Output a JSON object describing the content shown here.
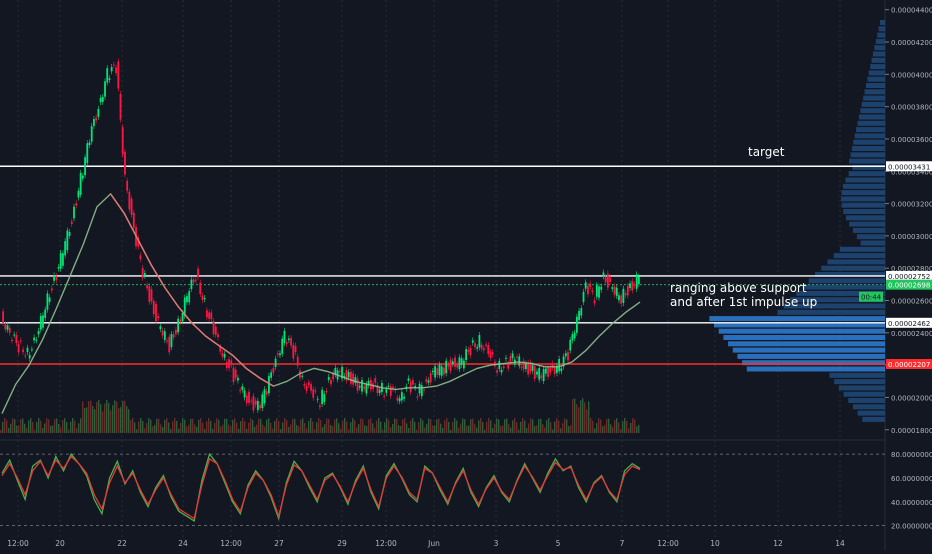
{
  "chart_data": [
    {
      "type": "candlestick",
      "title": "",
      "x_ticks": [
        "12:00",
        "20",
        "22",
        "24",
        "12:00",
        "27",
        "29",
        "12:00",
        "Jun",
        "3",
        "5",
        "7",
        "12:00",
        "10",
        "12",
        "14"
      ],
      "y_ticks": [
        "0.00004400",
        "0.00004200",
        "0.00004000",
        "0.00003800",
        "0.00003600",
        "0.00003400",
        "0.00003200",
        "0.00003000",
        "0.00002800",
        "0.00002600",
        "0.00002400",
        "0.00002200",
        "0.00002000",
        "0.00001800"
      ],
      "ylim": [
        1.78e-05,
        4.46e-05
      ],
      "price_series_points": [
        2.52e-05,
        2.38e-05,
        2.32e-05,
        2.28e-05,
        2.35e-05,
        2.58e-05,
        2.72e-05,
        2.9e-05,
        3.1e-05,
        3.35e-05,
        3.6e-05,
        3.8e-05,
        4e-05,
        4.04e-05,
        3.38e-05,
        3.02e-05,
        2.78e-05,
        2.58e-05,
        2.42e-05,
        2.32e-05,
        2.46e-05,
        2.62e-05,
        2.76e-05,
        2.58e-05,
        2.4e-05,
        2.28e-05,
        2.16e-05,
        2.06e-05,
        1.98e-05,
        1.94e-05,
        2.05e-05,
        2.24e-05,
        2.38e-05,
        2.28e-05,
        2.12e-05,
        2.02e-05,
        1.98e-05,
        2.1e-05,
        2.16e-05,
        2.14e-05,
        2.09e-05,
        2.06e-05,
        2.08e-05,
        2.05e-05,
        2.03e-05,
        2.01e-05,
        2.08e-05,
        2.03e-05,
        2.1e-05,
        2.16e-05,
        2.18e-05,
        2.21e-05,
        2.22e-05,
        2.3e-05,
        2.36e-05,
        2.26e-05,
        2.19e-05,
        2.21e-05,
        2.24e-05,
        2.2e-05,
        2.16e-05,
        2.14e-05,
        2.17e-05,
        2.2e-05,
        2.26e-05,
        2.5e-05,
        2.68e-05,
        2.62e-05,
        2.76e-05,
        2.66e-05,
        2.62e-05,
        2.68e-05,
        2.74e-05
      ],
      "moving_average_points": [
        1.9e-05,
        2.08e-05,
        2.2e-05,
        2.36e-05,
        2.55e-05,
        2.75e-05,
        2.95e-05,
        3.18e-05,
        3.26e-05,
        3.14e-05,
        2.98e-05,
        2.82e-05,
        2.68e-05,
        2.56e-05,
        2.46e-05,
        2.38e-05,
        2.32e-05,
        2.26e-05,
        2.18e-05,
        2.12e-05,
        2.07e-05,
        2.1e-05,
        2.15e-05,
        2.18e-05,
        2.16e-05,
        2.13e-05,
        2.1e-05,
        2.08e-05,
        2.06e-05,
        2.05e-05,
        2.06e-05,
        2.06e-05,
        2.07e-05,
        2.1e-05,
        2.14e-05,
        2.18e-05,
        2.2e-05,
        2.21e-05,
        2.22e-05,
        2.21e-05,
        2.19e-05,
        2.19e-05,
        2.22e-05,
        2.29e-05,
        2.38e-05,
        2.46e-05,
        2.53e-05,
        2.59e-05
      ],
      "horizontal_levels": [
        {
          "label": "0.00003431",
          "value": 3.431e-05,
          "color": "#ffffff",
          "annotation": "target"
        },
        {
          "label": "0.00002752",
          "value": 2.752e-05,
          "color": "#ffffff",
          "annotation": ""
        },
        {
          "label": "0.00002698",
          "value": 2.698e-05,
          "color": "#22c55e",
          "annotation": ""
        },
        {
          "label": "0.00002462",
          "value": 2.462e-05,
          "color": "#ffffff",
          "annotation": ""
        },
        {
          "label": "0.00002207",
          "value": 2.207e-05,
          "color": "#ff2d2d",
          "annotation": ""
        }
      ],
      "price_label_small": "00:44",
      "annotations": [
        "target",
        "ranging above support",
        "and after 1st impulse up"
      ],
      "grid": "vertical-dotted",
      "legend": "none"
    },
    {
      "type": "line",
      "title": "",
      "y_ticks": [
        "80.00000000",
        "60.00000000",
        "40.00000000",
        "20.00000000"
      ],
      "ylim": [
        18,
        86
      ],
      "bands": [
        80,
        20
      ],
      "series": [
        {
          "color": "#4caf50",
          "values": [
            64,
            75,
            58,
            42,
            70,
            75,
            60,
            78,
            66,
            80,
            72,
            62,
            42,
            30,
            60,
            74,
            55,
            66,
            48,
            36,
            52,
            62,
            44,
            32,
            28,
            24,
            58,
            80,
            72,
            56,
            40,
            30,
            54,
            66,
            58,
            44,
            26,
            56,
            74,
            66,
            52,
            40,
            60,
            64,
            52,
            38,
            58,
            70,
            48,
            34,
            62,
            72,
            60,
            46,
            40,
            70,
            64,
            50,
            38,
            56,
            68,
            48,
            36,
            52,
            62,
            48,
            40,
            58,
            72,
            60,
            48,
            64,
            76,
            66,
            70,
            52,
            40,
            56,
            62,
            48,
            40,
            66,
            72,
            68
          ]
        },
        {
          "color": "#e53935",
          "values": [
            62,
            72,
            60,
            46,
            66,
            74,
            62,
            75,
            68,
            78,
            72,
            64,
            46,
            34,
            56,
            70,
            56,
            64,
            50,
            38,
            50,
            60,
            46,
            34,
            30,
            26,
            54,
            76,
            72,
            58,
            42,
            32,
            52,
            64,
            58,
            46,
            28,
            54,
            71,
            66,
            54,
            42,
            58,
            63,
            53,
            40,
            56,
            68,
            50,
            36,
            60,
            70,
            61,
            48,
            42,
            68,
            64,
            52,
            40,
            55,
            66,
            50,
            38,
            51,
            60,
            49,
            42,
            57,
            70,
            61,
            50,
            62,
            73,
            67,
            69,
            54,
            42,
            55,
            61,
            49,
            42,
            63,
            70,
            67
          ]
        }
      ]
    }
  ]
}
